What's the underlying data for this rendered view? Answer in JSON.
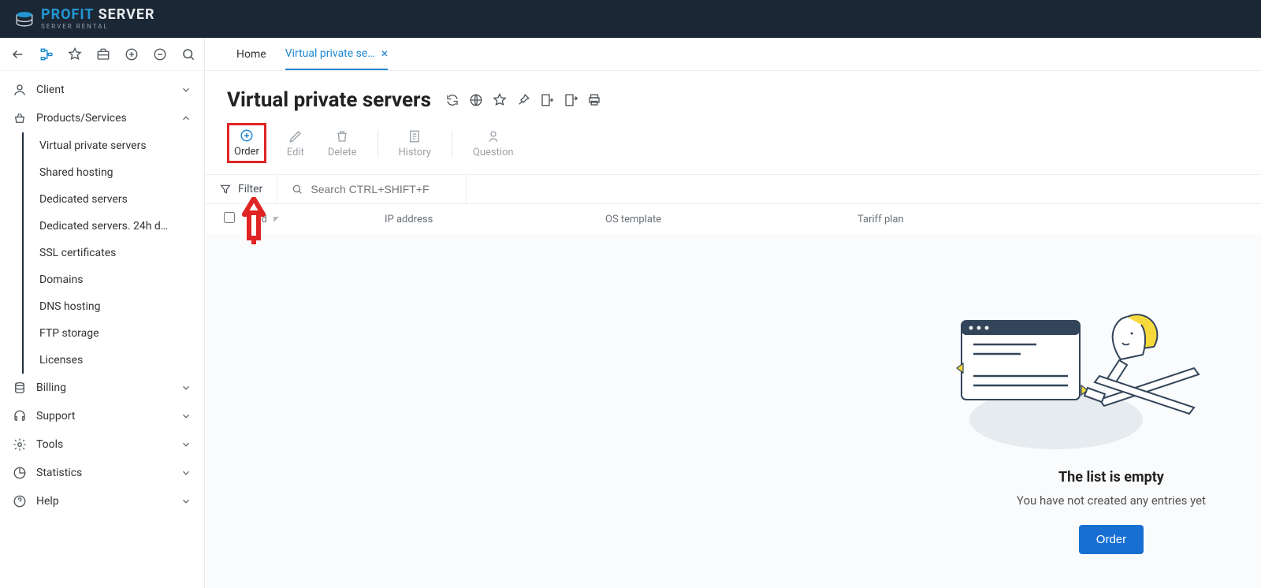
{
  "brand": {
    "p1": "PROFIT",
    "p2": " SERVER",
    "sub": "SERVER RENTAL"
  },
  "tabs": {
    "home": "Home",
    "vps": "Virtual private se…"
  },
  "sidebar": {
    "client": "Client",
    "products": "Products/Services",
    "items": [
      "Virtual private servers",
      "Shared hosting",
      "Dedicated servers",
      "Dedicated servers. 24h d…",
      "SSL certificates",
      "Domains",
      "DNS hosting",
      "FTP storage",
      "Licenses"
    ],
    "billing": "Billing",
    "support": "Support",
    "tools": "Tools",
    "statistics": "Statistics",
    "help": "Help"
  },
  "page": {
    "title": "Virtual private servers",
    "actions": {
      "order": "Order",
      "edit": "Edit",
      "delete": "Delete",
      "history": "History",
      "question": "Question"
    },
    "filter_label": "Filter",
    "search_placeholder": "Search CTRL+SHIFT+F",
    "columns": {
      "id": "Id",
      "ip": "IP address",
      "os": "OS template",
      "plan": "Tariff plan"
    },
    "empty": {
      "title": "The list is empty",
      "subtitle": "You have not created any entries yet",
      "button": "Order"
    }
  }
}
